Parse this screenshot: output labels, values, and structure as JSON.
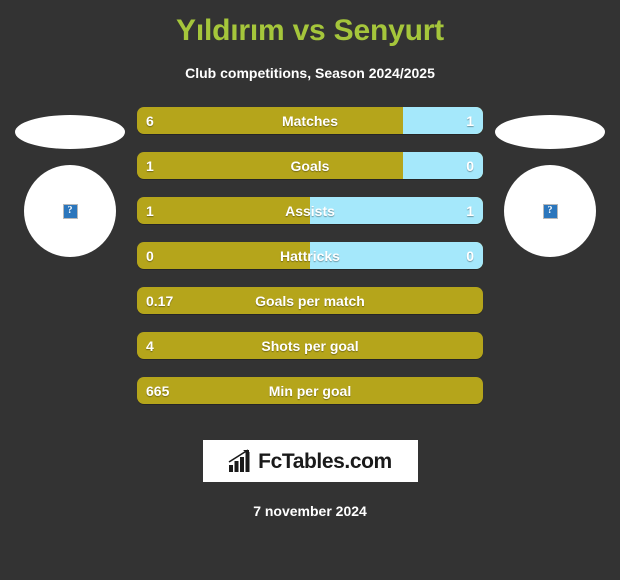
{
  "header": {
    "title": "Yıldırım vs Senyurt",
    "subtitle": "Club competitions, Season 2024/2025"
  },
  "players": {
    "left": {
      "placeholder_glyph": "?"
    },
    "right": {
      "placeholder_glyph": "?"
    }
  },
  "footer": {
    "logo_text": "FcTables.com",
    "date": "7 november 2024"
  },
  "colors": {
    "background": "#333333",
    "title": "#a5c63b",
    "home_bar": "#b5a51b",
    "away_bar": "#a5e8fb",
    "text": "#ffffff"
  },
  "chart_data": {
    "type": "bar",
    "title": "Yıldırım vs Senyurt",
    "subtitle": "Club competitions, Season 2024/2025",
    "orientation": "horizontal-diverging",
    "series": [
      {
        "name": "Yıldırım",
        "side": "left",
        "color": "#b5a51b"
      },
      {
        "name": "Senyurt",
        "side": "right",
        "color": "#a5e8fb"
      }
    ],
    "categories": [
      "Matches",
      "Goals",
      "Assists",
      "Hattricks",
      "Goals per match",
      "Shots per goal",
      "Min per goal"
    ],
    "rows": [
      {
        "label": "Matches",
        "home": "6",
        "away": "1",
        "home_pct": 77,
        "has_away": true
      },
      {
        "label": "Goals",
        "home": "1",
        "away": "0",
        "home_pct": 77,
        "has_away": true
      },
      {
        "label": "Assists",
        "home": "1",
        "away": "1",
        "home_pct": 50,
        "has_away": true
      },
      {
        "label": "Hattricks",
        "home": "0",
        "away": "0",
        "home_pct": 50,
        "has_away": true
      },
      {
        "label": "Goals per match",
        "home": "0.17",
        "away": "",
        "home_pct": 100,
        "has_away": false
      },
      {
        "label": "Shots per goal",
        "home": "4",
        "away": "",
        "home_pct": 100,
        "has_away": false
      },
      {
        "label": "Min per goal",
        "home": "665",
        "away": "",
        "home_pct": 100,
        "has_away": false
      }
    ],
    "legend": {
      "position": "none"
    },
    "grid": false,
    "annotations": [
      "7 november 2024",
      "FcTables.com"
    ]
  }
}
